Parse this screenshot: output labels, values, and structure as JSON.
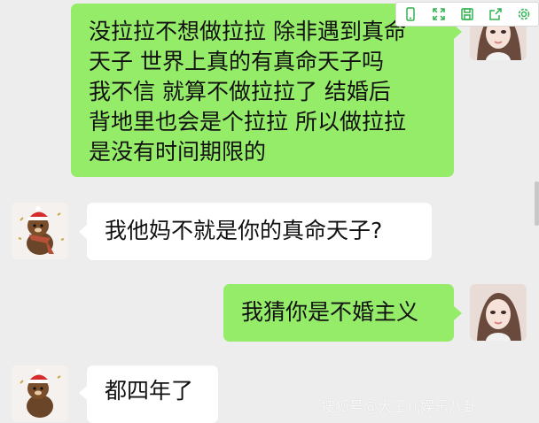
{
  "toolbar": {
    "buttons": [
      {
        "icon": "phone-icon"
      },
      {
        "icon": "expand-icon"
      },
      {
        "icon": "save-icon"
      },
      {
        "icon": "share-icon"
      },
      {
        "icon": "settings-icon"
      }
    ],
    "accent": "#2fb24f"
  },
  "messages": [
    {
      "side": "right",
      "lines": [
        "没拉拉不想做拉拉 除非遇到真命",
        "天子 世界上真的有真命天子吗",
        "我不信 就算不做拉拉了 结婚后",
        "背地里也会是个拉拉 所以做拉拉",
        "是没有时间期限的"
      ]
    },
    {
      "side": "left",
      "lines": [
        "我他妈不就是你的真命天子?"
      ]
    },
    {
      "side": "right",
      "lines": [
        "我猜你是不婚主义"
      ]
    },
    {
      "side": "left",
      "lines": [
        "都四年了"
      ]
    }
  ],
  "watermark": "搜狐号@大玉儿娱乐八卦"
}
